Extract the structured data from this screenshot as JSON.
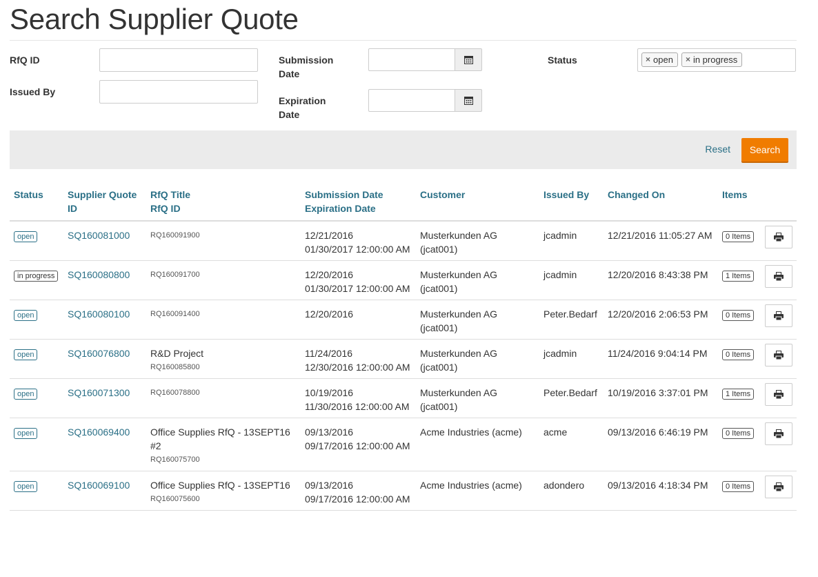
{
  "page": {
    "title": "Search Supplier Quote"
  },
  "form": {
    "rfq_id_label": "RfQ ID",
    "issued_by_label": "Issued By",
    "submission_label_1": "Submission",
    "submission_label_2": "Date",
    "expiration_label_1": "Expiration",
    "expiration_label_2": "Date",
    "status_label": "Status",
    "status_chips": [
      "open",
      "in progress"
    ],
    "chip_remove": "×"
  },
  "toolbar": {
    "reset_label": "Reset",
    "search_label": "Search"
  },
  "table": {
    "headers": {
      "status": "Status",
      "sq_1": "Supplier Quote",
      "sq_2": "ID",
      "rfq_1": "RfQ Title",
      "rfq_2": "RfQ ID",
      "date_1": "Submission Date",
      "date_2": "Expiration Date",
      "customer": "Customer",
      "issued_by": "Issued By",
      "changed_on": "Changed On",
      "items": "Items"
    },
    "rows": [
      {
        "status": "open",
        "sq_id": "SQ160081000",
        "rfq_title": "",
        "rfq_id": "RQ160091900",
        "submission": "12/21/2016",
        "expiration": "01/30/2017 12:00:00 AM",
        "customer": "Musterkunden AG (jcat001)",
        "issued_by": "jcadmin",
        "changed_on": "12/21/2016 11:05:27 AM",
        "items": "0 Items"
      },
      {
        "status": "in progress",
        "sq_id": "SQ160080800",
        "rfq_title": "",
        "rfq_id": "RQ160091700",
        "submission": "12/20/2016",
        "expiration": "01/30/2017 12:00:00 AM",
        "customer": "Musterkunden AG (jcat001)",
        "issued_by": "jcadmin",
        "changed_on": "12/20/2016 8:43:38 PM",
        "items": "1 Items"
      },
      {
        "status": "open",
        "sq_id": "SQ160080100",
        "rfq_title": "",
        "rfq_id": "RQ160091400",
        "submission": "12/20/2016",
        "expiration": "",
        "customer": "Musterkunden AG (jcat001)",
        "issued_by": "Peter.Bedarf",
        "changed_on": "12/20/2016 2:06:53 PM",
        "items": "0 Items"
      },
      {
        "status": "open",
        "sq_id": "SQ160076800",
        "rfq_title": "R&D Project",
        "rfq_id": "RQ160085800",
        "submission": "11/24/2016",
        "expiration": "12/30/2016 12:00:00 AM",
        "customer": "Musterkunden AG (jcat001)",
        "issued_by": "jcadmin",
        "changed_on": "11/24/2016 9:04:14 PM",
        "items": "0 Items"
      },
      {
        "status": "open",
        "sq_id": "SQ160071300",
        "rfq_title": "",
        "rfq_id": "RQ160078800",
        "submission": "10/19/2016",
        "expiration": "11/30/2016 12:00:00 AM",
        "customer": "Musterkunden AG (jcat001)",
        "issued_by": "Peter.Bedarf",
        "changed_on": "10/19/2016 3:37:01 PM",
        "items": "1 Items"
      },
      {
        "status": "open",
        "sq_id": "SQ160069400",
        "rfq_title": "Office Supplies RfQ - 13SEPT16 #2",
        "rfq_id": "RQ160075700",
        "submission": "09/13/2016",
        "expiration": "09/17/2016 12:00:00 AM",
        "customer": "Acme Industries (acme)",
        "issued_by": "acme",
        "changed_on": "09/13/2016 6:46:19 PM",
        "items": "0 Items"
      },
      {
        "status": "open",
        "sq_id": "SQ160069100",
        "rfq_title": "Office Supplies RfQ - 13SEPT16",
        "rfq_id": "RQ160075600",
        "submission": "09/13/2016",
        "expiration": "09/17/2016 12:00:00 AM",
        "customer": "Acme Industries (acme)",
        "issued_by": "adondero",
        "changed_on": "09/13/2016 4:18:34 PM",
        "items": "0 Items"
      }
    ]
  },
  "icons": {
    "calendar": "calendar-icon",
    "print": "print-icon",
    "remove": "remove-icon"
  },
  "colors": {
    "accent": "#2a6f86",
    "primary_button": "#f07c00",
    "toolbar_bg": "#ebebeb"
  }
}
